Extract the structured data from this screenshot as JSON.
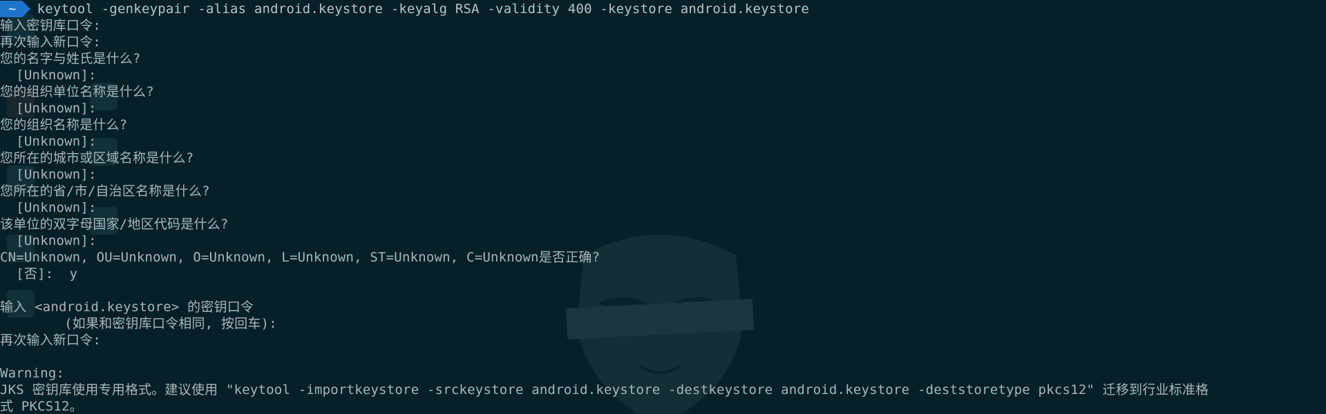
{
  "prompt": {
    "dir_symbol": "~",
    "command": "keytool -genkeypair -alias android.keystore -keyalg RSA -validity 400 -keystore android.keystore"
  },
  "output_lines": [
    "输入密钥库口令:",
    "再次输入新口令:",
    "您的名字与姓氏是什么?",
    "  [Unknown]:",
    "您的组织单位名称是什么?",
    "  [Unknown]:",
    "您的组织名称是什么?",
    "  [Unknown]:",
    "您所在的城市或区域名称是什么?",
    "  [Unknown]:",
    "您所在的省/市/自治区名称是什么?",
    "  [Unknown]:",
    "该单位的双字母国家/地区代码是什么?",
    "  [Unknown]:",
    "CN=Unknown, OU=Unknown, O=Unknown, L=Unknown, ST=Unknown, C=Unknown是否正确?",
    "  [否]:  y",
    "",
    "输入 <android.keystore> 的密钥口令",
    "        (如果和密钥库口令相同, 按回车):",
    "再次输入新口令:",
    "",
    "Warning:",
    "JKS 密钥库使用专用格式。建议使用 \"keytool -importkeystore -srckeystore android.keystore -destkeystore android.keystore -deststoretype pkcs12\" 迁移到行业标准格",
    "式 PKCS12。"
  ],
  "colors": {
    "background": "#062029",
    "text": "#aab6b8",
    "prompt_bg": "#1e74c9"
  }
}
